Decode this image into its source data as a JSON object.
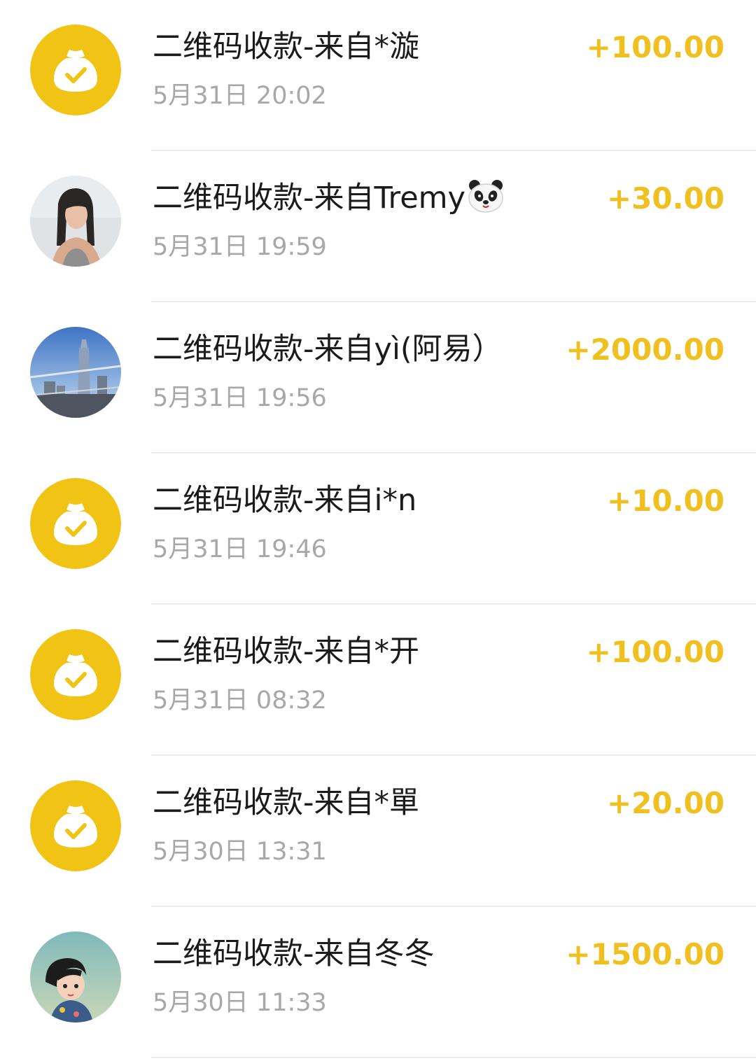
{
  "transactions": [
    {
      "title": "二维码收款-来自*漩",
      "time": "5月31日 20:02",
      "amount": "+100.00",
      "avatar": "money-bag-icon"
    },
    {
      "title": "二维码收款-来自Tremy",
      "title_suffix_icon": "panda-face-icon",
      "time": "5月31日 19:59",
      "amount": "+30.00",
      "avatar": "user-photo-girl"
    },
    {
      "title": "二维码收款-来自yì(阿易）",
      "time": "5月31日 19:56",
      "amount": "+2000.00",
      "avatar": "user-photo-skyline"
    },
    {
      "title": "二维码收款-来自i*n",
      "time": "5月31日 19:46",
      "amount": "+10.00",
      "avatar": "money-bag-icon"
    },
    {
      "title": "二维码收款-来自*开",
      "time": "5月31日 08:32",
      "amount": "+100.00",
      "avatar": "money-bag-icon"
    },
    {
      "title": "二维码收款-来自*單",
      "time": "5月30日 13:31",
      "amount": "+20.00",
      "avatar": "money-bag-icon"
    },
    {
      "title": "二维码收款-来自冬冬",
      "time": "5月30日 11:33",
      "amount": "+1500.00",
      "avatar": "user-photo-cartoon"
    }
  ],
  "colors": {
    "accent": "#f0c020",
    "bag_circle": "#f0c315",
    "title": "#1b1b1b",
    "time": "#a8a8a8",
    "divider": "#ececec"
  }
}
